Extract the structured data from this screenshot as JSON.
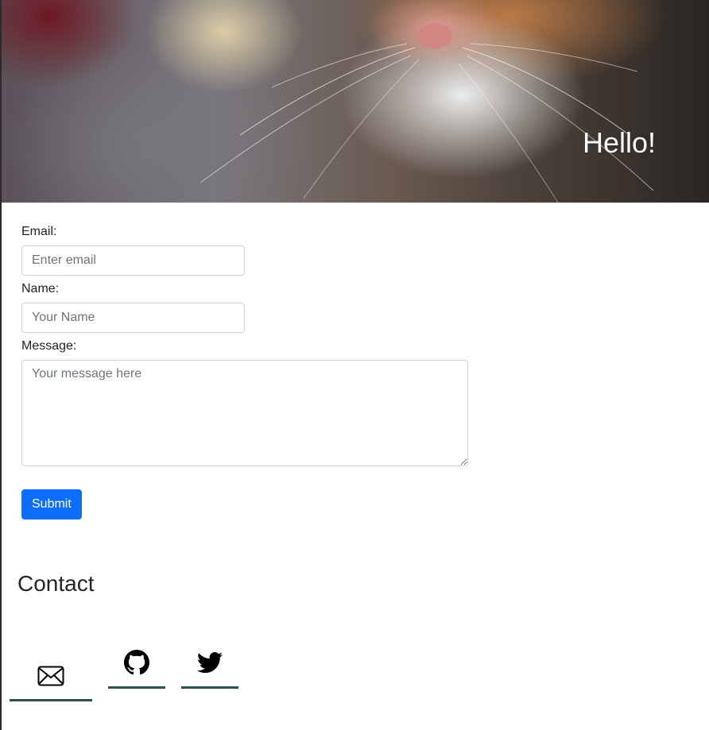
{
  "hero": {
    "title": "Hello!",
    "image": "cat-photo"
  },
  "form": {
    "email_label": "Email:",
    "email_placeholder": "Enter email",
    "email_value": "",
    "name_label": "Name:",
    "name_placeholder": "Your Name",
    "name_value": "",
    "message_label": "Message:",
    "message_placeholder": "Your message here",
    "message_value": "",
    "submit_label": "Submit"
  },
  "contact": {
    "title": "Contact",
    "links": [
      {
        "icon": "envelope-icon"
      },
      {
        "icon": "github-icon"
      },
      {
        "icon": "twitter-icon"
      }
    ]
  },
  "colors": {
    "primary": "#0d6efd",
    "underline": "#2f4f4f",
    "text": "#212529"
  }
}
